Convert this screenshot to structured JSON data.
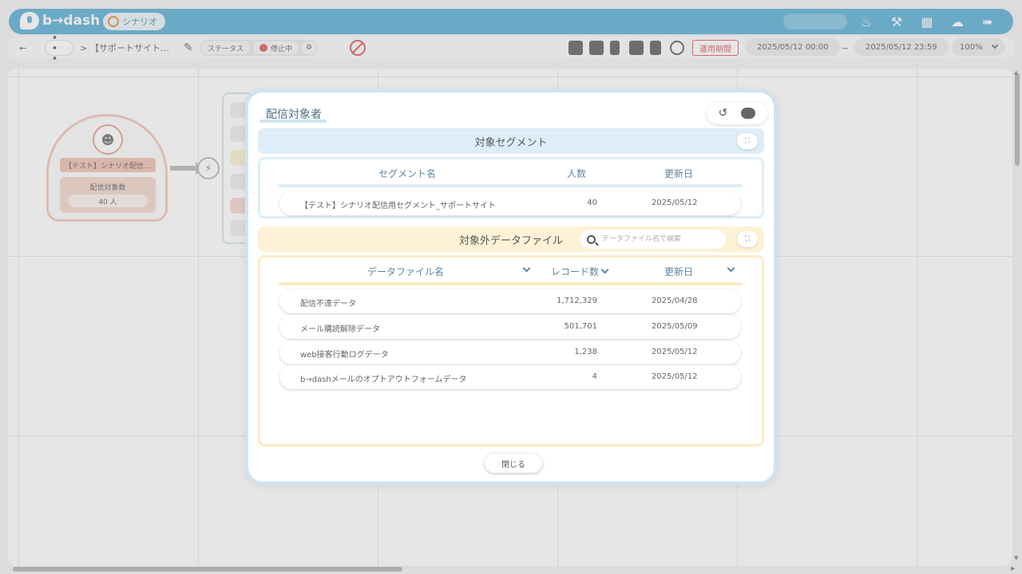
{
  "header": {
    "logo": "b→dash",
    "scenario_label": "シナリオ"
  },
  "toolbar": {
    "back": "←",
    "more": "• • •",
    "breadcrumb_sep": ">",
    "breadcrumb": "【サポートサイト…",
    "status_label": "ステータス",
    "status_value": "停止中",
    "period_button": "運用期間",
    "date_start": "2025/05/12 00:00",
    "date_sep": "~",
    "date_end": "2025/05/12 23:59",
    "zoom": "100%"
  },
  "canvas": {
    "node_title": "【テスト】シナリオ配信…",
    "node_sub_label": "配信対象数",
    "node_sub_value": "40 人"
  },
  "modal": {
    "title": "配信対象者",
    "segment_section": {
      "title": "対象セグメント",
      "columns": [
        "セグメント名",
        "人数",
        "更新日"
      ],
      "rows": [
        {
          "name": "【テスト】シナリオ配信用セグメント_サポートサイト",
          "count": "40",
          "date": "2025/05/12"
        }
      ]
    },
    "exclude_section": {
      "title": "対象外データファイル",
      "search_placeholder": "データファイル名で検索",
      "columns": [
        "データファイル名",
        "レコード数",
        "更新日"
      ],
      "rows": [
        {
          "name": "配信不達データ",
          "count": "1,712,329",
          "date": "2025/04/28"
        },
        {
          "name": "メール購読解除データ",
          "count": "501,701",
          "date": "2025/05/09"
        },
        {
          "name": "web接客行動ログデータ",
          "count": "1,238",
          "date": "2025/05/12"
        },
        {
          "name": "b→dashメールのオプトアウトフォームデータ",
          "count": "4",
          "date": "2025/05/12"
        }
      ]
    },
    "close_button": "閉じる"
  }
}
